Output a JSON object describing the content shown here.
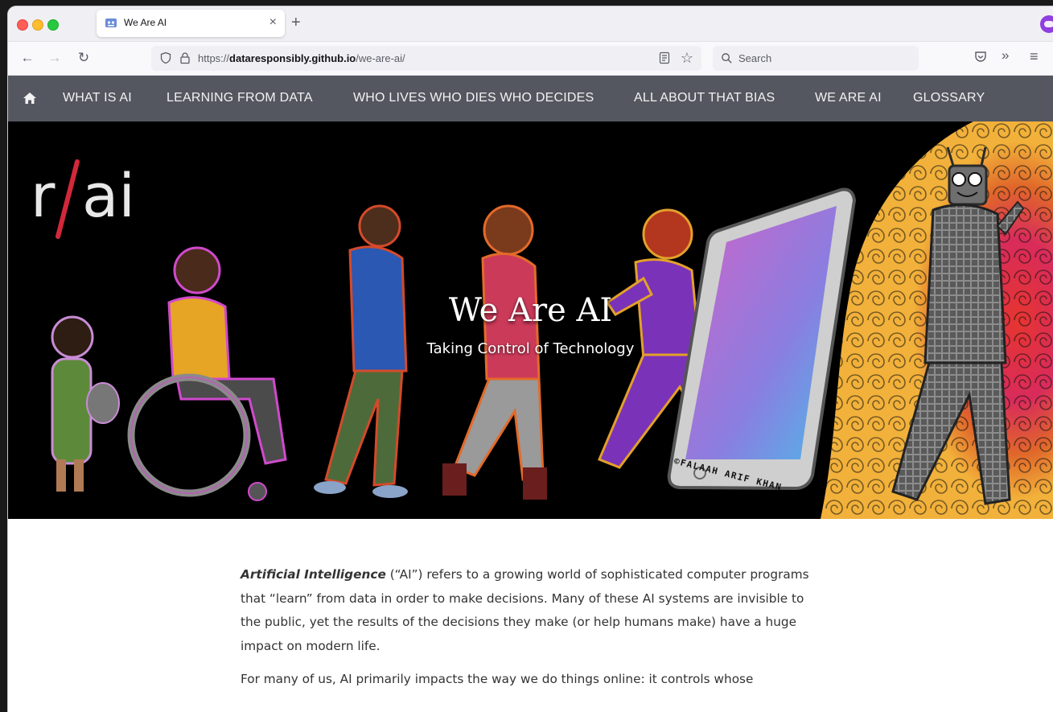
{
  "browser": {
    "tab_title": "We Are AI",
    "url_prefix": "https://",
    "url_host": "dataresponsibly.github.io",
    "url_path": "/we-are-ai/",
    "search_placeholder": "Search"
  },
  "site_nav": {
    "items": [
      {
        "label": "WHAT IS AI"
      },
      {
        "label": "LEARNING FROM DATA"
      },
      {
        "label": "WHO LIVES WHO DIES WHO DECIDES"
      },
      {
        "label": "ALL ABOUT THAT BIAS"
      },
      {
        "label": "WE ARE AI"
      },
      {
        "label": "GLOSSARY"
      }
    ]
  },
  "hero": {
    "logo_text": "r/ai",
    "title": "We Are AI",
    "subtitle": "Taking Control of Technology",
    "signature": "©FALAAH ARIF KHAN"
  },
  "article": {
    "p1_term": "Artificial Intelligence",
    "p1_text": " (“AI”) refers to a growing world of sophisticated computer programs that “learn” from data in order to make decisions. Many of these AI systems are invisible to the public, yet the results of the decisions they make (or help humans make) have a huge impact on modern life.",
    "p2_text": "For many of us, AI primarily impacts the way we do things online: it controls whose"
  },
  "colors": {
    "nav_bg": "#545760",
    "hero_bg": "#000000",
    "logo_slash": "#d3283a"
  }
}
